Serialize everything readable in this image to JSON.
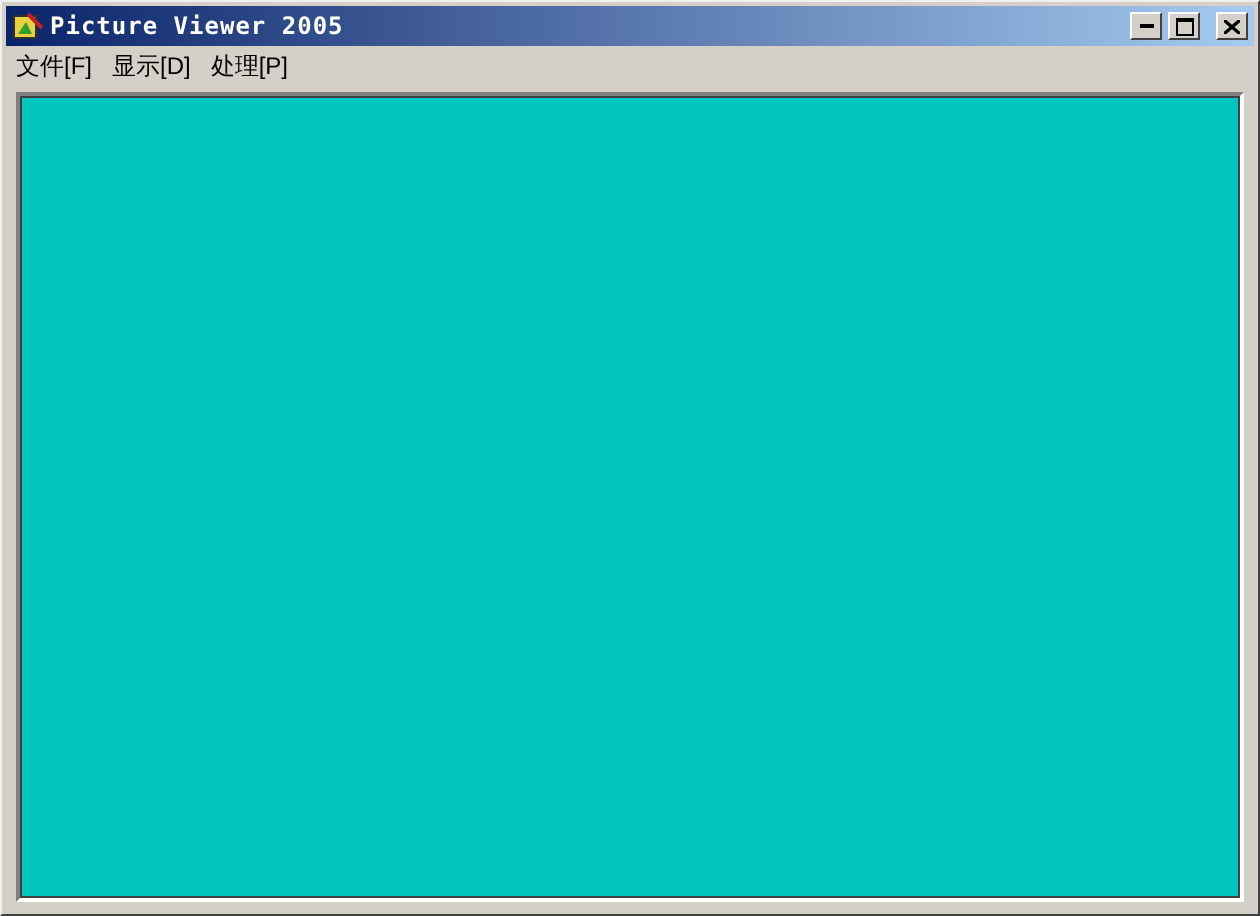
{
  "window": {
    "title": "Picture Viewer 2005"
  },
  "menu": [
    {
      "label": "文件[F]"
    },
    {
      "label": "显示[D]"
    },
    {
      "label": "处理[P]"
    }
  ]
}
